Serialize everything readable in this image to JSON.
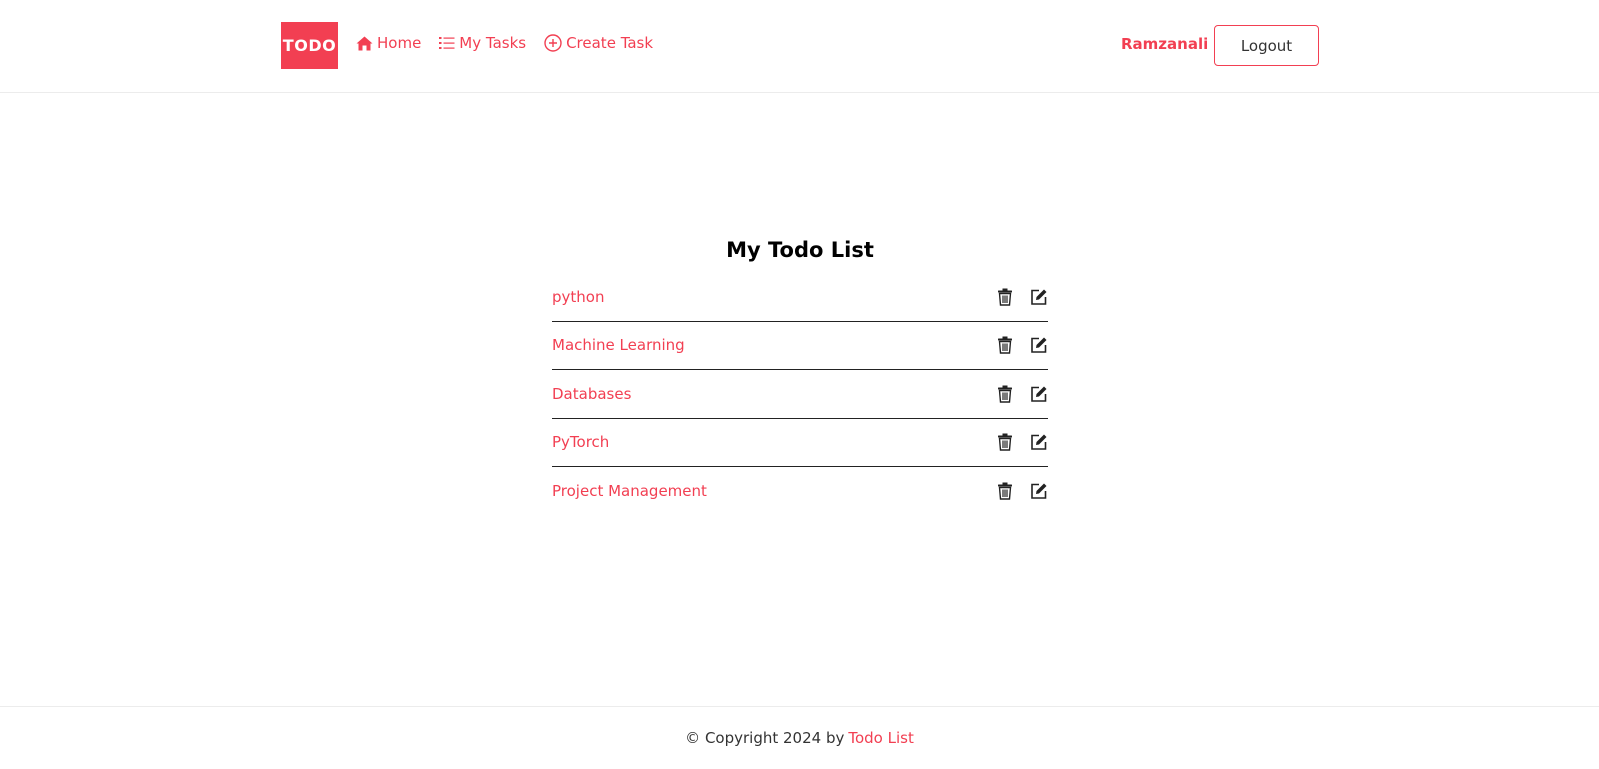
{
  "navbar": {
    "brand": "TODO",
    "links": [
      {
        "label": "Home",
        "icon": "home-icon"
      },
      {
        "label": "My Tasks",
        "icon": "list-icon"
      },
      {
        "label": "Create Task",
        "icon": "plus-circle-icon"
      }
    ],
    "user_name": "Ramzanali",
    "logout_label": "Logout"
  },
  "main": {
    "title": "My Todo List",
    "todos": [
      {
        "title": "python"
      },
      {
        "title": "Machine Learning"
      },
      {
        "title": "Databases"
      },
      {
        "title": "PyTorch"
      },
      {
        "title": "Project Management"
      }
    ],
    "action_icons": [
      "trash-icon",
      "edit-icon"
    ]
  },
  "footer": {
    "copyright": "© Copyright 2024 by",
    "link_label": "Todo List"
  },
  "colors": {
    "accent": "#f23f52",
    "text": "#212529",
    "divider": "#222222"
  }
}
